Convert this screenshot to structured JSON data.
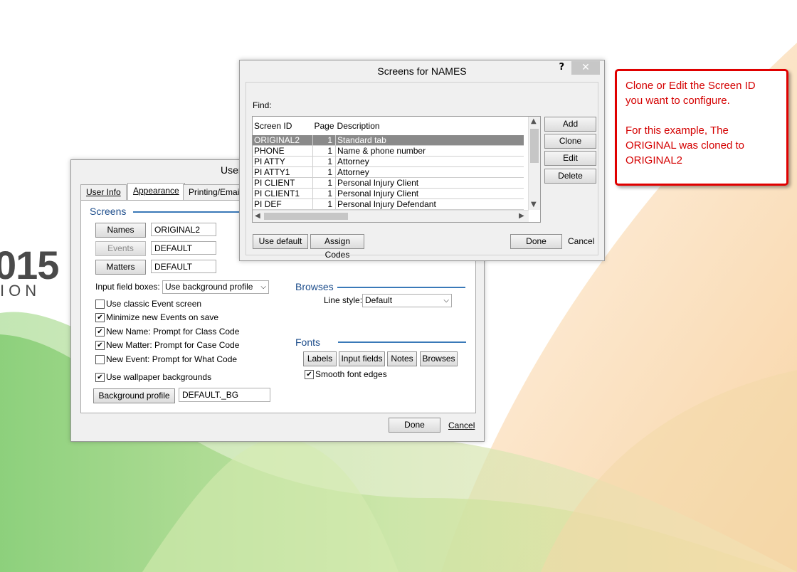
{
  "brand": {
    "year": "015",
    "subtitle": "ION"
  },
  "user_dialog": {
    "title": "User",
    "tabs": [
      {
        "label": "User Info"
      },
      {
        "label": "Appearance"
      },
      {
        "label": "Printing/Email"
      }
    ],
    "screens_heading": "Screens",
    "names_button": "Names",
    "names_value": "ORIGINAL2",
    "events_button": "Events",
    "events_value": "DEFAULT",
    "matters_button": "Matters",
    "matters_value": "DEFAULT",
    "input_boxes_label": "Input field boxes:",
    "input_boxes_value": "Use background profile",
    "checkboxes": [
      {
        "label": "Use classic Event screen",
        "checked": false
      },
      {
        "label": "Minimize new Events on save",
        "checked": true
      },
      {
        "label": "New Name: Prompt for Class Code",
        "checked": true
      },
      {
        "label": "New Matter: Prompt for Case Code",
        "checked": true
      },
      {
        "label": "New Event: Prompt for What Code",
        "checked": false
      },
      {
        "label": "Use wallpaper backgrounds",
        "checked": true
      }
    ],
    "background_profile_button": "Background profile",
    "background_profile_value": "DEFAULT._BG",
    "browses_heading": "Browses",
    "line_style_label": "Line style:",
    "line_style_value": "Default",
    "fonts_heading": "Fonts",
    "font_buttons": {
      "labels": "Labels",
      "input_fields": "Input fields",
      "notes": "Notes",
      "browses": "Browses"
    },
    "smooth_fonts_label": "Smooth font edges",
    "smooth_fonts_checked": true,
    "done_label": "Done",
    "cancel_label": "Cancel"
  },
  "screens_dialog": {
    "title": "Screens for NAMES",
    "help": "?",
    "close": "✕",
    "find_label": "Find:",
    "columns": [
      "Screen ID",
      "Page",
      "Description"
    ],
    "rows": [
      {
        "id": "ORIGINAL2",
        "page": "1",
        "desc": "Standard tab",
        "selected": true
      },
      {
        "id": "PHONE",
        "page": "1",
        "desc": "Name & phone number"
      },
      {
        "id": "PI ATTY",
        "page": "1",
        "desc": "Attorney"
      },
      {
        "id": "PI ATTY1",
        "page": "1",
        "desc": "Attorney"
      },
      {
        "id": "PI CLIENT",
        "page": "1",
        "desc": "Personal Injury Client"
      },
      {
        "id": "PI CLIENT1",
        "page": "1",
        "desc": "Personal Injury Client"
      },
      {
        "id": "PI DEF",
        "page": "1",
        "desc": "Personal Injury Defendant"
      }
    ],
    "side_buttons": {
      "add": "Add",
      "clone": "Clone",
      "edit": "Edit",
      "delete": "Delete"
    },
    "use_default_label": "Use default",
    "assign_codes_label": "Assign Codes",
    "done_label": "Done",
    "cancel_label": "Cancel"
  },
  "callout": {
    "line1": "Clone or Edit the Screen ID",
    "line2": "you want to configure.",
    "line3": "For this example, The",
    "line4": "ORIGINAL was cloned to",
    "line5": "ORIGINAL2"
  }
}
